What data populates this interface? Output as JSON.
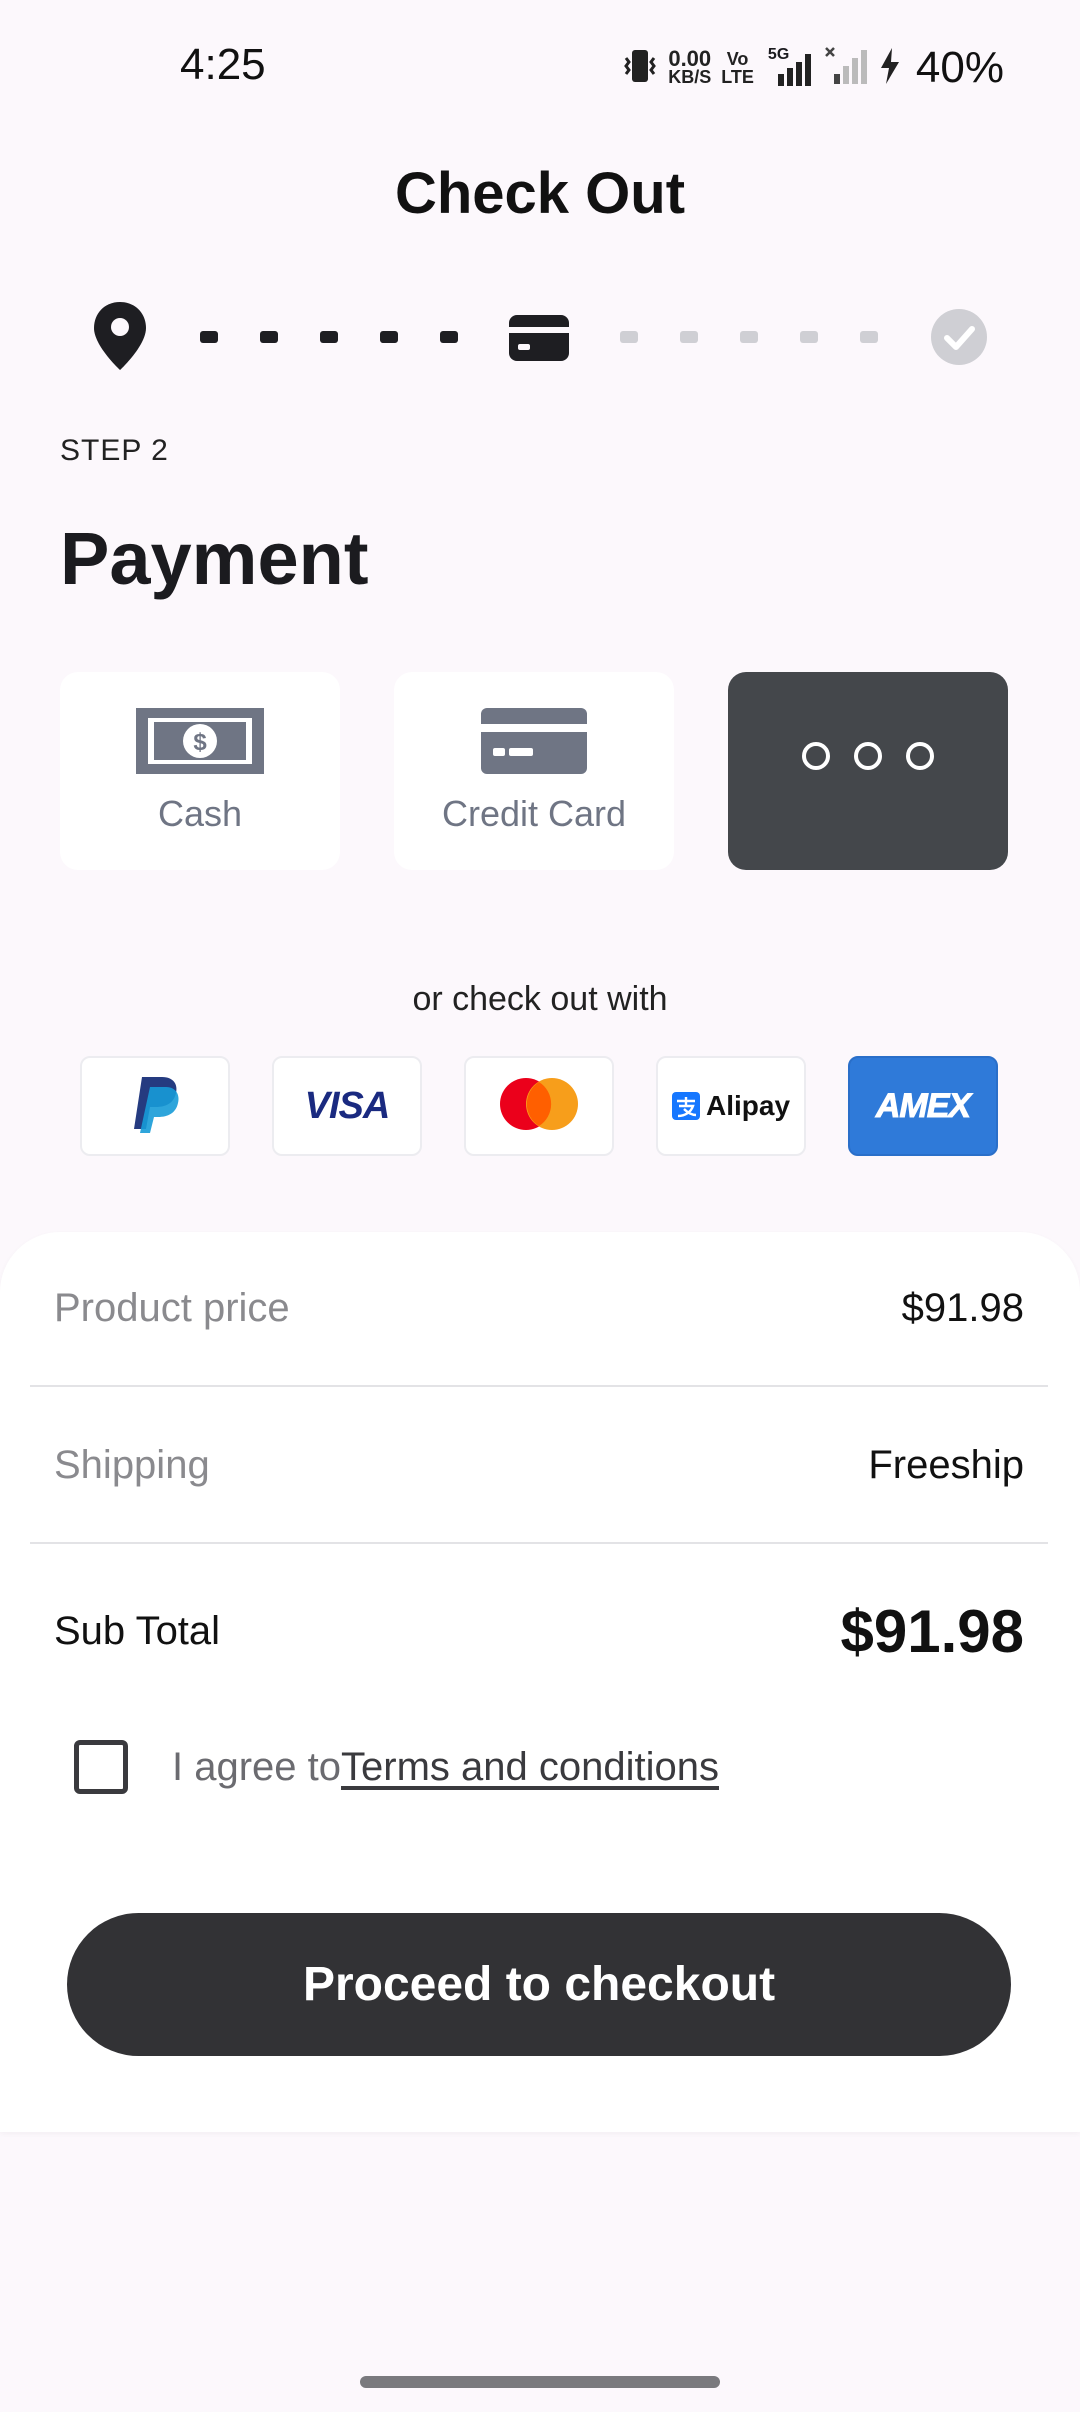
{
  "status_bar": {
    "time": "4:25",
    "net_speed_value": "0.00",
    "net_speed_unit": "KB/S",
    "volte_top": "Vo",
    "volte_bottom": "LTE",
    "network": "5G",
    "battery": "40%"
  },
  "page": {
    "title": "Check Out"
  },
  "stepper": {
    "steps": [
      {
        "icon": "location-pin-icon",
        "state": "done"
      },
      {
        "icon": "credit-card-icon",
        "state": "active"
      },
      {
        "icon": "check-circle-icon",
        "state": "pending"
      }
    ]
  },
  "payment": {
    "step_label": "STEP 2",
    "title": "Payment",
    "methods": [
      {
        "label": "Cash",
        "icon": "cash-icon",
        "selected": false
      },
      {
        "label": "Credit Card",
        "icon": "credit-card-icon",
        "selected": false
      },
      {
        "label": "",
        "icon": "more-dots-icon",
        "selected": true
      }
    ],
    "alt_label": "or check out with",
    "brands": [
      {
        "name": "PayPal",
        "icon": "paypal-logo"
      },
      {
        "name": "VISA",
        "icon": "visa-logo"
      },
      {
        "name": "Mastercard",
        "icon": "mastercard-logo"
      },
      {
        "name": "Alipay",
        "icon": "alipay-logo"
      },
      {
        "name": "AMEX",
        "icon": "amex-logo"
      }
    ]
  },
  "summary": {
    "product_price_label": "Product price",
    "product_price_value": "$91.98",
    "shipping_label": "Shipping",
    "shipping_value": "Freeship",
    "subtotal_label": "Sub Total",
    "subtotal_value": "$91.98"
  },
  "agreement": {
    "checked": false,
    "prefix": "I agree to",
    "link": "Terms and conditions"
  },
  "cta": {
    "label": "Proceed to checkout"
  },
  "colors": {
    "background": "#fcf8fc",
    "dark": "#323235",
    "selected_card": "#44474b",
    "muted_icon": "#6f7584",
    "amex_blue": "#2f7ad9"
  }
}
